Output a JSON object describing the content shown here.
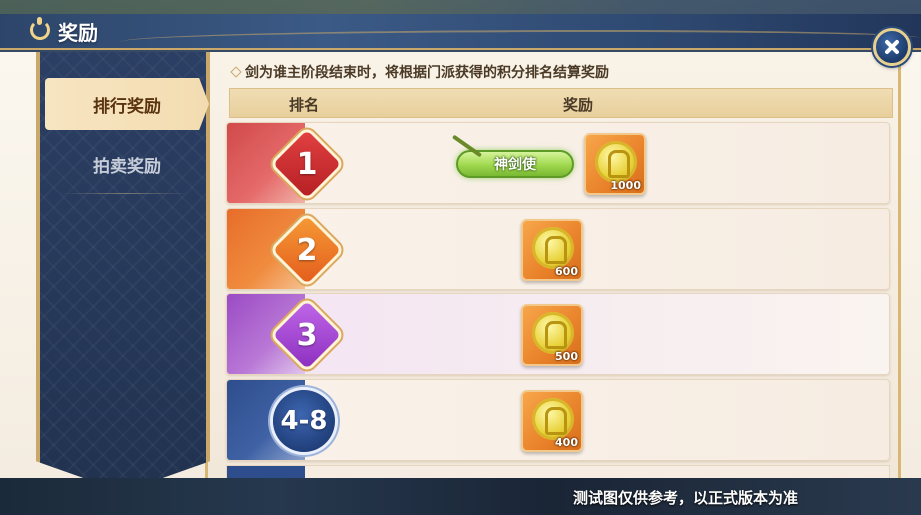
{
  "header": {
    "title": "奖励",
    "title_icon": "moon-swirl-icon",
    "close_icon": "close-icon"
  },
  "sidebar": {
    "tabs": [
      {
        "label": "排行奖励",
        "selected": true
      },
      {
        "label": "拍卖奖励",
        "selected": false
      }
    ]
  },
  "main": {
    "description": "剑为谁主阶段结束时，将根据门派获得的积分排名结算奖励",
    "table": {
      "headers": [
        "排名",
        "奖励"
      ],
      "rows": [
        {
          "rank": "1",
          "accent_color": "#d14a4a",
          "title_reward": "神剑使",
          "coin_count": "1000"
        },
        {
          "rank": "2",
          "accent_color": "#e76d2a",
          "coin_count": "600"
        },
        {
          "rank": "3",
          "accent_color": "#9b4bc4",
          "coin_count": "500"
        },
        {
          "rank": "4-8",
          "accent_color": "#2e4d8c",
          "coin_count": "400"
        }
      ]
    }
  },
  "footer": {
    "disclaimer": "测试图仅供参考，以正式版本为准"
  },
  "colors": {
    "gold_border": "#c9a86a",
    "panel_bg": "#f9f2e7",
    "sidebar_bg": "#2b3f64"
  }
}
